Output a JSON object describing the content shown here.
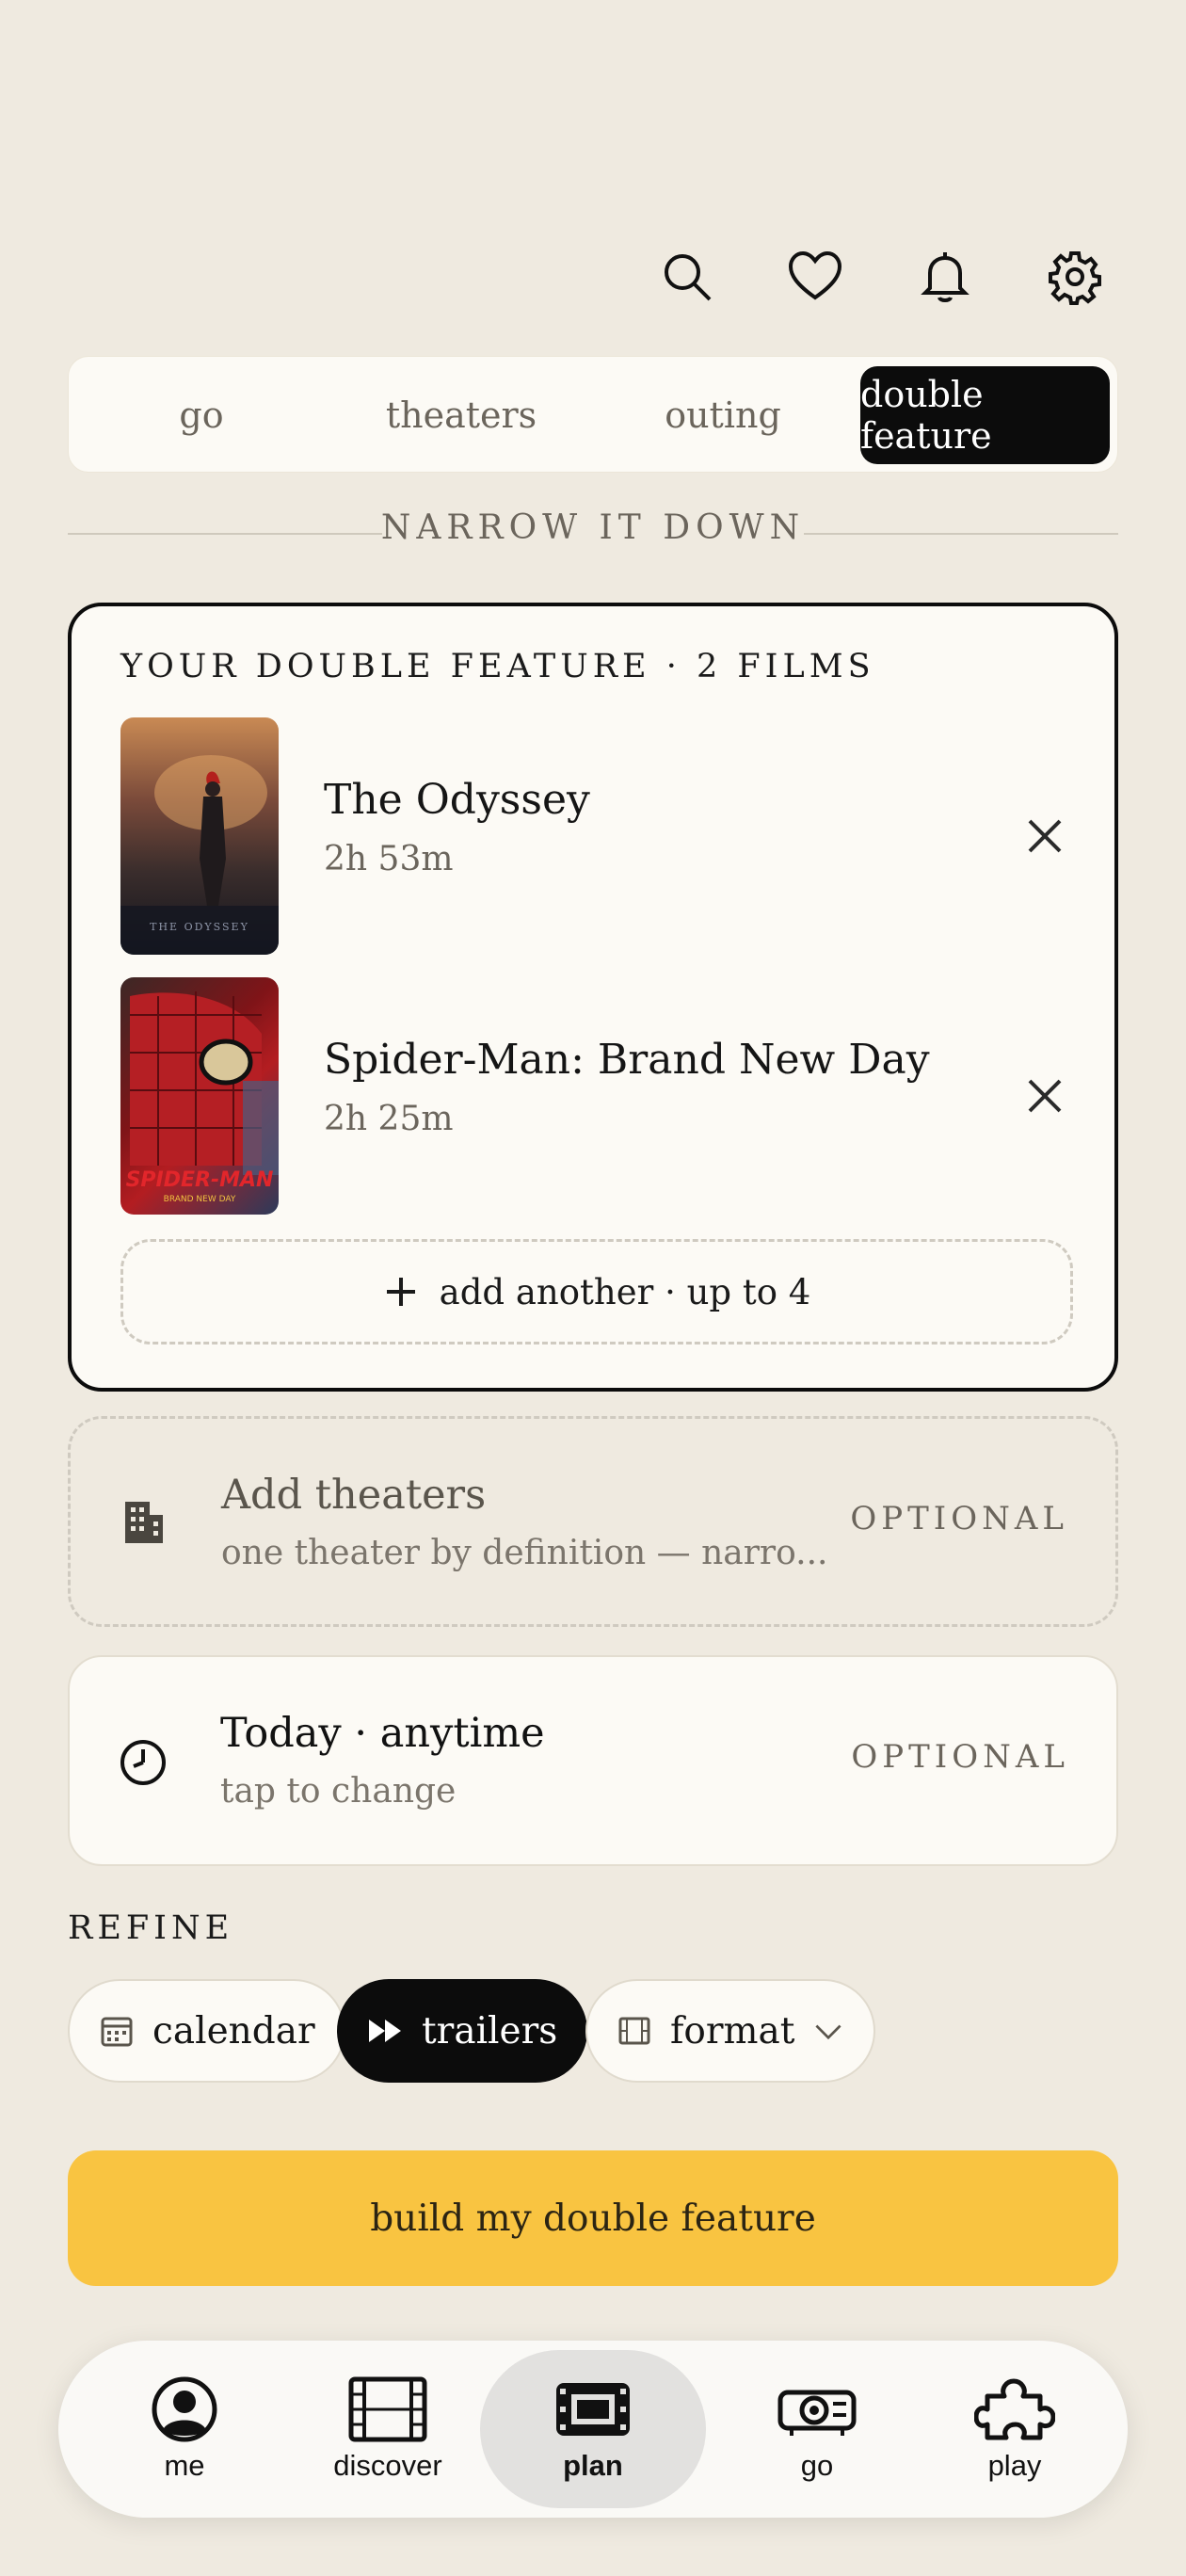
{
  "header_icons": [
    "search-icon",
    "heart-icon",
    "bell-icon",
    "gear-icon"
  ],
  "tabs": [
    {
      "label": "go",
      "active": false
    },
    {
      "label": "theaters",
      "active": false
    },
    {
      "label": "outing",
      "active": false
    },
    {
      "label": "double feature",
      "active": true
    }
  ],
  "section_title": "NARROW IT DOWN",
  "feature": {
    "heading": "YOUR DOUBLE FEATURE · 2 FILMS",
    "films": [
      {
        "title": "The Odyssey",
        "runtime": "2h 53m",
        "poster_text": "THE ODYSSEY"
      },
      {
        "title": "Spider-Man: Brand New Day",
        "runtime": "2h 25m",
        "poster_text": "SPIDER-MAN",
        "poster_subtext": "BRAND NEW DAY"
      }
    ],
    "add_label": "add another · up to 4"
  },
  "theaters_option": {
    "title": "Add theaters",
    "subtitle": "one theater by definition — narro...",
    "tag": "OPTIONAL"
  },
  "time_option": {
    "title": "Today · anytime",
    "subtitle": "tap to change",
    "tag": "OPTIONAL"
  },
  "refine": {
    "label": "REFINE",
    "chips": [
      {
        "label": "calendar",
        "icon": "calendar-icon",
        "active": false
      },
      {
        "label": "trailers",
        "icon": "fast-forward-icon",
        "active": true
      },
      {
        "label": "format",
        "icon": "film-frame-icon",
        "active": false
      }
    ]
  },
  "cta_label": "build my double feature",
  "nav": [
    {
      "label": "me",
      "icon": "person-icon",
      "active": false
    },
    {
      "label": "discover",
      "icon": "film-strip-icon",
      "active": false
    },
    {
      "label": "plan",
      "icon": "ticket-film-icon",
      "active": true
    },
    {
      "label": "go",
      "icon": "projector-icon",
      "active": false
    },
    {
      "label": "play",
      "icon": "puzzle-icon",
      "active": false
    }
  ],
  "colors": {
    "background": "#efeae0",
    "card": "#fcfaf5",
    "accent": "#f9c441",
    "active": "#0c0c0c"
  }
}
